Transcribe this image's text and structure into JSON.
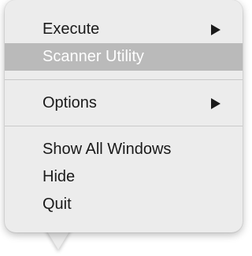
{
  "menu": {
    "items": [
      {
        "label": "Execute",
        "submenu": true
      },
      {
        "label": "Scanner Utility",
        "highlighted": true
      },
      {
        "label": "Options",
        "submenu": true
      },
      {
        "label": "Show All Windows"
      },
      {
        "label": "Hide"
      },
      {
        "label": "Quit"
      }
    ]
  },
  "colors": {
    "menu_background": "#ececec",
    "highlight_background": "#bababa",
    "highlight_text": "#ffffff",
    "text": "#1a1a1a",
    "separator": "#c9c9c9"
  },
  "icons": {
    "submenu": "submenu-arrow-icon"
  }
}
